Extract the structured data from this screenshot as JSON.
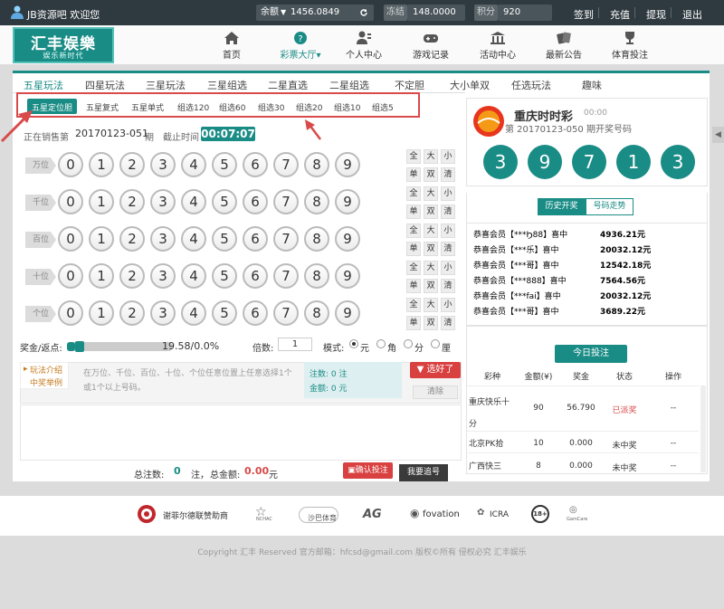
{
  "topbar": {
    "username": "JB资源吧 欢迎您",
    "balance_label": "余额",
    "balance_value": "1456.0849",
    "frozen_label": "冻结",
    "frozen_value": "148.0000",
    "points_label": "积分",
    "points_value": "920",
    "links": [
      "签到",
      "充值",
      "提现",
      "退出"
    ]
  },
  "logo": {
    "title": "汇丰娱樂",
    "slogan": "娱乐新时代"
  },
  "nav": {
    "items": [
      {
        "label": "首页",
        "icon": "home-icon"
      },
      {
        "label": "彩票大厅",
        "icon": "lottery-icon",
        "active": true
      },
      {
        "label": "个人中心",
        "icon": "user-icon"
      },
      {
        "label": "游戏记录",
        "icon": "gamepad-icon"
      },
      {
        "label": "活动中心",
        "icon": "bank-icon"
      },
      {
        "label": "最新公告",
        "icon": "cards-icon"
      },
      {
        "label": "体育投注",
        "icon": "trophy-icon"
      }
    ],
    "dropdown_glyph": "▾"
  },
  "play_tabs": [
    "五星玩法",
    "四星玩法",
    "三星玩法",
    "三星组选",
    "二星直选",
    "二星组选",
    "不定胆",
    "大小单双",
    "任选玩法",
    "趣味"
  ],
  "sub_tabs": [
    "五星定位胆",
    "五星复式",
    "五星单式",
    "组选120",
    "组选60",
    "组选30",
    "组选20",
    "组选10",
    "组选5"
  ],
  "sale": {
    "label": "正在销售第",
    "issue": "20170123-051",
    "issue_suffix": "期",
    "deadline_label": "截止时间",
    "countdown": "00:07:07"
  },
  "positions": [
    "万位",
    "千位",
    "百位",
    "十位",
    "个位"
  ],
  "digits": [
    "0",
    "1",
    "2",
    "3",
    "4",
    "5",
    "6",
    "7",
    "8",
    "9"
  ],
  "quick_buttons": [
    "全",
    "大",
    "小",
    "单",
    "双",
    "清"
  ],
  "controls": {
    "rebate_label": "奖金/返点:",
    "rebate_value": "19.58/0.0%",
    "rebate_level": 0.08,
    "multiple_label": "倍数:",
    "multiple_value": "1",
    "mode_label": "模式:",
    "modes": [
      "元",
      "角",
      "分",
      "厘"
    ],
    "selected_mode": "元"
  },
  "info": {
    "intro_label": "玩法介绍",
    "example_label": "中奖举例",
    "description": "在万位、千位、百位、十位、个位任意位置上任意选择1个或1个以上号码。",
    "bets_text": "注数: 0 注",
    "amount_text": "金额: 0 元",
    "select_button": "选好了",
    "clear_button": "清除"
  },
  "summary": {
    "total_bets_label": "总注数:",
    "total_bets": "0",
    "bets_unit": "注，",
    "total_amount_label": "总金额:",
    "total_amount": "0.00",
    "amount_unit": "元",
    "confirm_button": "确认投注",
    "chase_button": "我要追号"
  },
  "result": {
    "lottery_name": "重庆时时彩",
    "time": "00:00",
    "issue_text": "第 20170123-050 期开奖号码",
    "numbers": [
      "3",
      "9",
      "7",
      "1",
      "3"
    ]
  },
  "history_tabs": [
    "历史开奖",
    "号码走势"
  ],
  "winners": [
    {
      "user": "恭喜会员【***Ϧ88】喜中",
      "amount": "4936.21元"
    },
    {
      "user": "恭喜会员【***乐】喜中",
      "amount": "20032.12元"
    },
    {
      "user": "恭喜会员【***哥】喜中",
      "amount": "12542.18元"
    },
    {
      "user": "恭喜会员【***888】喜中",
      "amount": "7564.56元"
    },
    {
      "user": "恭喜会员【***fai】喜中",
      "amount": "20032.12元"
    },
    {
      "user": "恭喜会员【***哥】喜中",
      "amount": "3689.22元"
    }
  ],
  "today": {
    "title": "今日投注",
    "headers": [
      "彩种",
      "金额(¥)",
      "奖金",
      "状态",
      "操作"
    ],
    "rows": [
      {
        "game": "重庆快乐十分",
        "amount": "90",
        "bonus": "56.790",
        "status": "已派奖",
        "op": "--"
      },
      {
        "game": "北京PK拾",
        "amount": "10",
        "bonus": "0.000",
        "status": "未中奖",
        "op": "--"
      },
      {
        "game": "广西快三",
        "amount": "8",
        "bonus": "0.000",
        "status": "未中奖",
        "op": "--"
      }
    ]
  },
  "partners": [
    "谢菲尔德联赞助商",
    "NCHAC",
    "沙巴体育",
    "AG",
    "fovation",
    "ICRA",
    "18+",
    "GamCare"
  ],
  "copyright": "Copyright 汇丰 Reserved 官方邮箱：hfcsd@gmail.com 版权©所有 侵权必究 汇丰娱乐",
  "colors": {
    "accent": "#1a8c86",
    "highlight": "#d94a4a",
    "topbar": "#2f3a40"
  }
}
